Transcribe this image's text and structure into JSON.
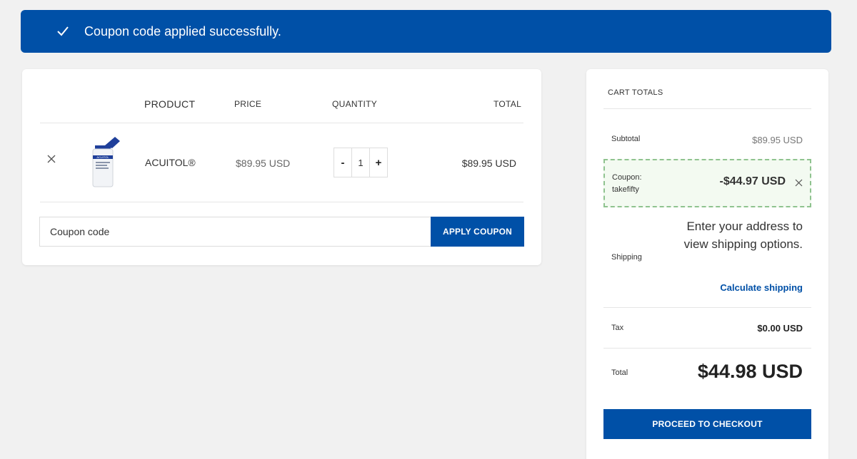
{
  "notice": {
    "message": "Coupon code applied successfully.",
    "icon": "check-icon"
  },
  "cart": {
    "headers": {
      "product": "PRODUCT",
      "price": "PRICE",
      "quantity": "QUANTITY",
      "total": "TOTAL"
    },
    "item": {
      "name": "ACUITOL®",
      "image_label": "ACUITOL",
      "price": "$89.95 USD",
      "quantity": "1",
      "total": "$89.95 USD",
      "minus": "-",
      "plus": "+"
    },
    "coupon": {
      "placeholder": "Coupon code",
      "apply_label": "APPLY COUPON"
    }
  },
  "totals": {
    "heading": "CART TOTALS",
    "subtotal_label": "Subtotal",
    "subtotal_value": "$89.95 USD",
    "coupon_label_1": "Coupon:",
    "coupon_label_2": "takefifty",
    "coupon_value": "-$44.97 USD",
    "shipping_label": "Shipping",
    "shipping_text": "Enter your address to view shipping options.",
    "calculate_link": "Calculate shipping",
    "tax_label": "Tax",
    "tax_value": "$0.00 USD",
    "total_label": "Total",
    "total_value": "$44.98 USD",
    "checkout_label": "PROCEED TO CHECKOUT"
  },
  "colors": {
    "brand_blue": "#0050a7",
    "coupon_border": "#8fc38f",
    "background": "#f1f1f1"
  }
}
